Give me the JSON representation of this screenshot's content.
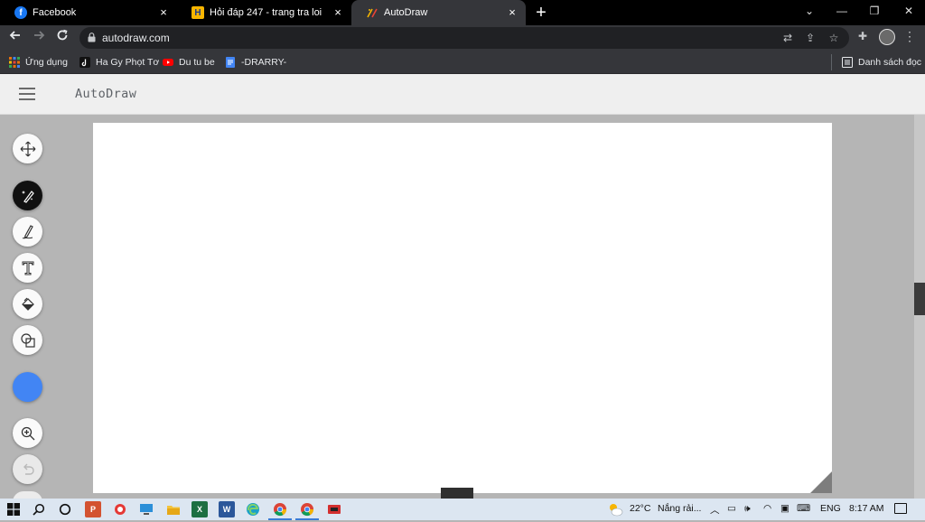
{
  "browser": {
    "tabs": [
      {
        "title": "Facebook",
        "icon": "facebook-icon",
        "active": false
      },
      {
        "title": "Hỏi đáp 247 - trang tra loi",
        "icon": "hoidap-icon",
        "active": false
      },
      {
        "title": "AutoDraw",
        "icon": "autodraw-icon",
        "active": true
      }
    ],
    "tab_close": "×",
    "new_tab": "+",
    "window_controls": {
      "dropdown": "⌄",
      "minimize": "—",
      "restore": "❐",
      "close": "✕"
    },
    "url": "autodraw.com",
    "bookmarks": [
      {
        "label": "Ứng dụng",
        "icon": "apps-grid-icon"
      },
      {
        "label": "Ha Gy Phọt Tơ",
        "icon": "tiktok-icon"
      },
      {
        "label": "Du tu be",
        "icon": "youtube-icon"
      },
      {
        "label": "-DRARRY-",
        "icon": "docs-icon"
      }
    ],
    "reading_list": "Danh sách đọc"
  },
  "app": {
    "title": "AutoDraw",
    "tools": [
      {
        "name": "select-move",
        "icon": "move-icon"
      },
      {
        "name": "autodraw",
        "icon": "autodraw-sparkle-icon",
        "active": true
      },
      {
        "name": "draw",
        "icon": "pencil-icon"
      },
      {
        "name": "type",
        "icon": "text-icon"
      },
      {
        "name": "fill",
        "icon": "paint-bucket-icon"
      },
      {
        "name": "shape",
        "icon": "shapes-icon"
      },
      {
        "name": "color",
        "icon": "color-swatch",
        "value": "#4285f4"
      },
      {
        "name": "zoom",
        "icon": "zoom-icon"
      },
      {
        "name": "undo",
        "icon": "undo-icon",
        "disabled": true
      }
    ]
  },
  "taskbar": {
    "weather": "22°C",
    "weather_text": "Nắng rải...",
    "language": "ENG",
    "time": "8:17 AM"
  },
  "colors": {
    "accent": "#4285f4",
    "workspace": "#b5b5b5",
    "header": "#efefef"
  }
}
